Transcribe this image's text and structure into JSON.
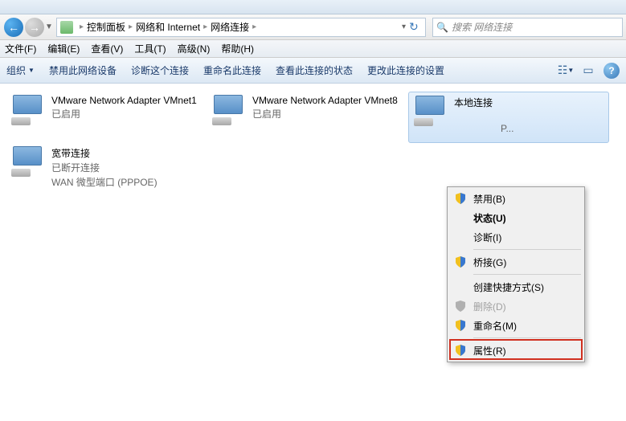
{
  "breadcrumb": {
    "root": "控制面板",
    "level1": "网络和 Internet",
    "level2": "网络连接"
  },
  "search": {
    "placeholder": "搜索 网络连接"
  },
  "menubar": {
    "file": "文件(F)",
    "edit": "编辑(E)",
    "view": "查看(V)",
    "tools": "工具(T)",
    "advanced": "高级(N)",
    "help": "帮助(H)"
  },
  "toolbar": {
    "organize": "组织",
    "disable": "禁用此网络设备",
    "diagnose": "诊断这个连接",
    "rename": "重命名此连接",
    "viewstatus": "查看此连接的状态",
    "changesettings": "更改此连接的设置"
  },
  "connections": [
    {
      "name": "VMware Network Adapter VMnet1",
      "status": "已启用",
      "extra": ""
    },
    {
      "name": "VMware Network Adapter VMnet8",
      "status": "已启用",
      "extra": ""
    },
    {
      "name": "本地连接",
      "status": "",
      "extra": "",
      "trail": "P..."
    },
    {
      "name": "宽带连接",
      "status": "已断开连接",
      "extra": "WAN 微型端口 (PPPOE)"
    }
  ],
  "context": {
    "disable": "禁用(B)",
    "status": "状态(U)",
    "diagnose": "诊断(I)",
    "bridge": "桥接(G)",
    "shortcut": "创建快捷方式(S)",
    "delete": "删除(D)",
    "rename": "重命名(M)",
    "properties": "属性(R)"
  }
}
